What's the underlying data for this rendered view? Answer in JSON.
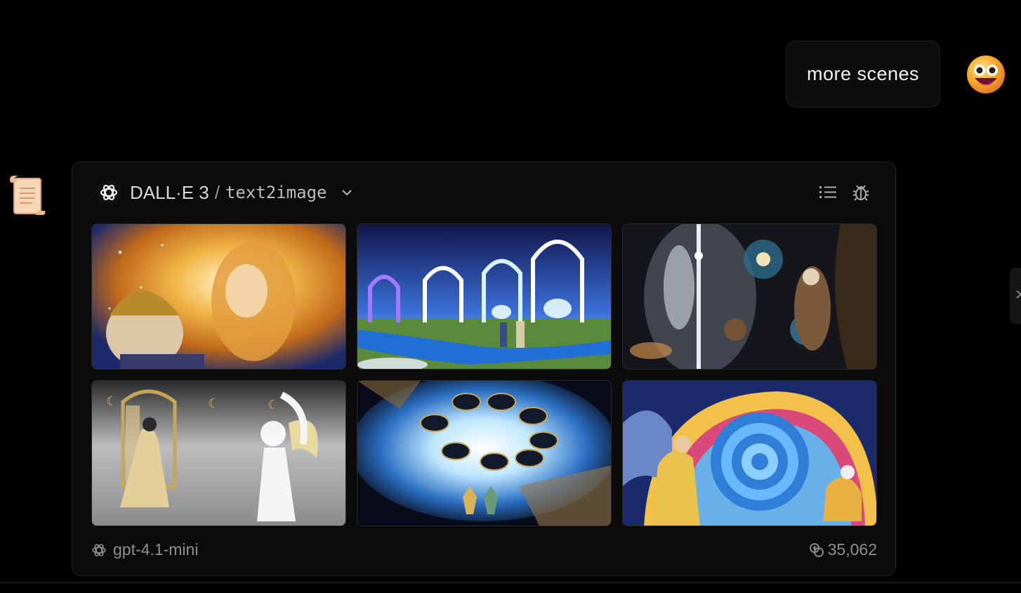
{
  "user_message": {
    "text": "more scenes"
  },
  "plugin": {
    "name": "DALL·E 3",
    "separator": "/",
    "api": "text2image"
  },
  "images": [
    {
      "icon": "image-golden-faces"
    },
    {
      "icon": "image-portal-arches"
    },
    {
      "icon": "image-cosmic-figures"
    },
    {
      "icon": "image-silver-angel-gate"
    },
    {
      "icon": "image-circle-of-portals"
    },
    {
      "icon": "image-angel-spiral"
    }
  ],
  "footer": {
    "model": "gpt-4.1-mini",
    "tokens": "35,062"
  },
  "colors": {
    "background": "#000000",
    "card": "#0b0b0b",
    "text_muted": "#8f8f8f"
  }
}
